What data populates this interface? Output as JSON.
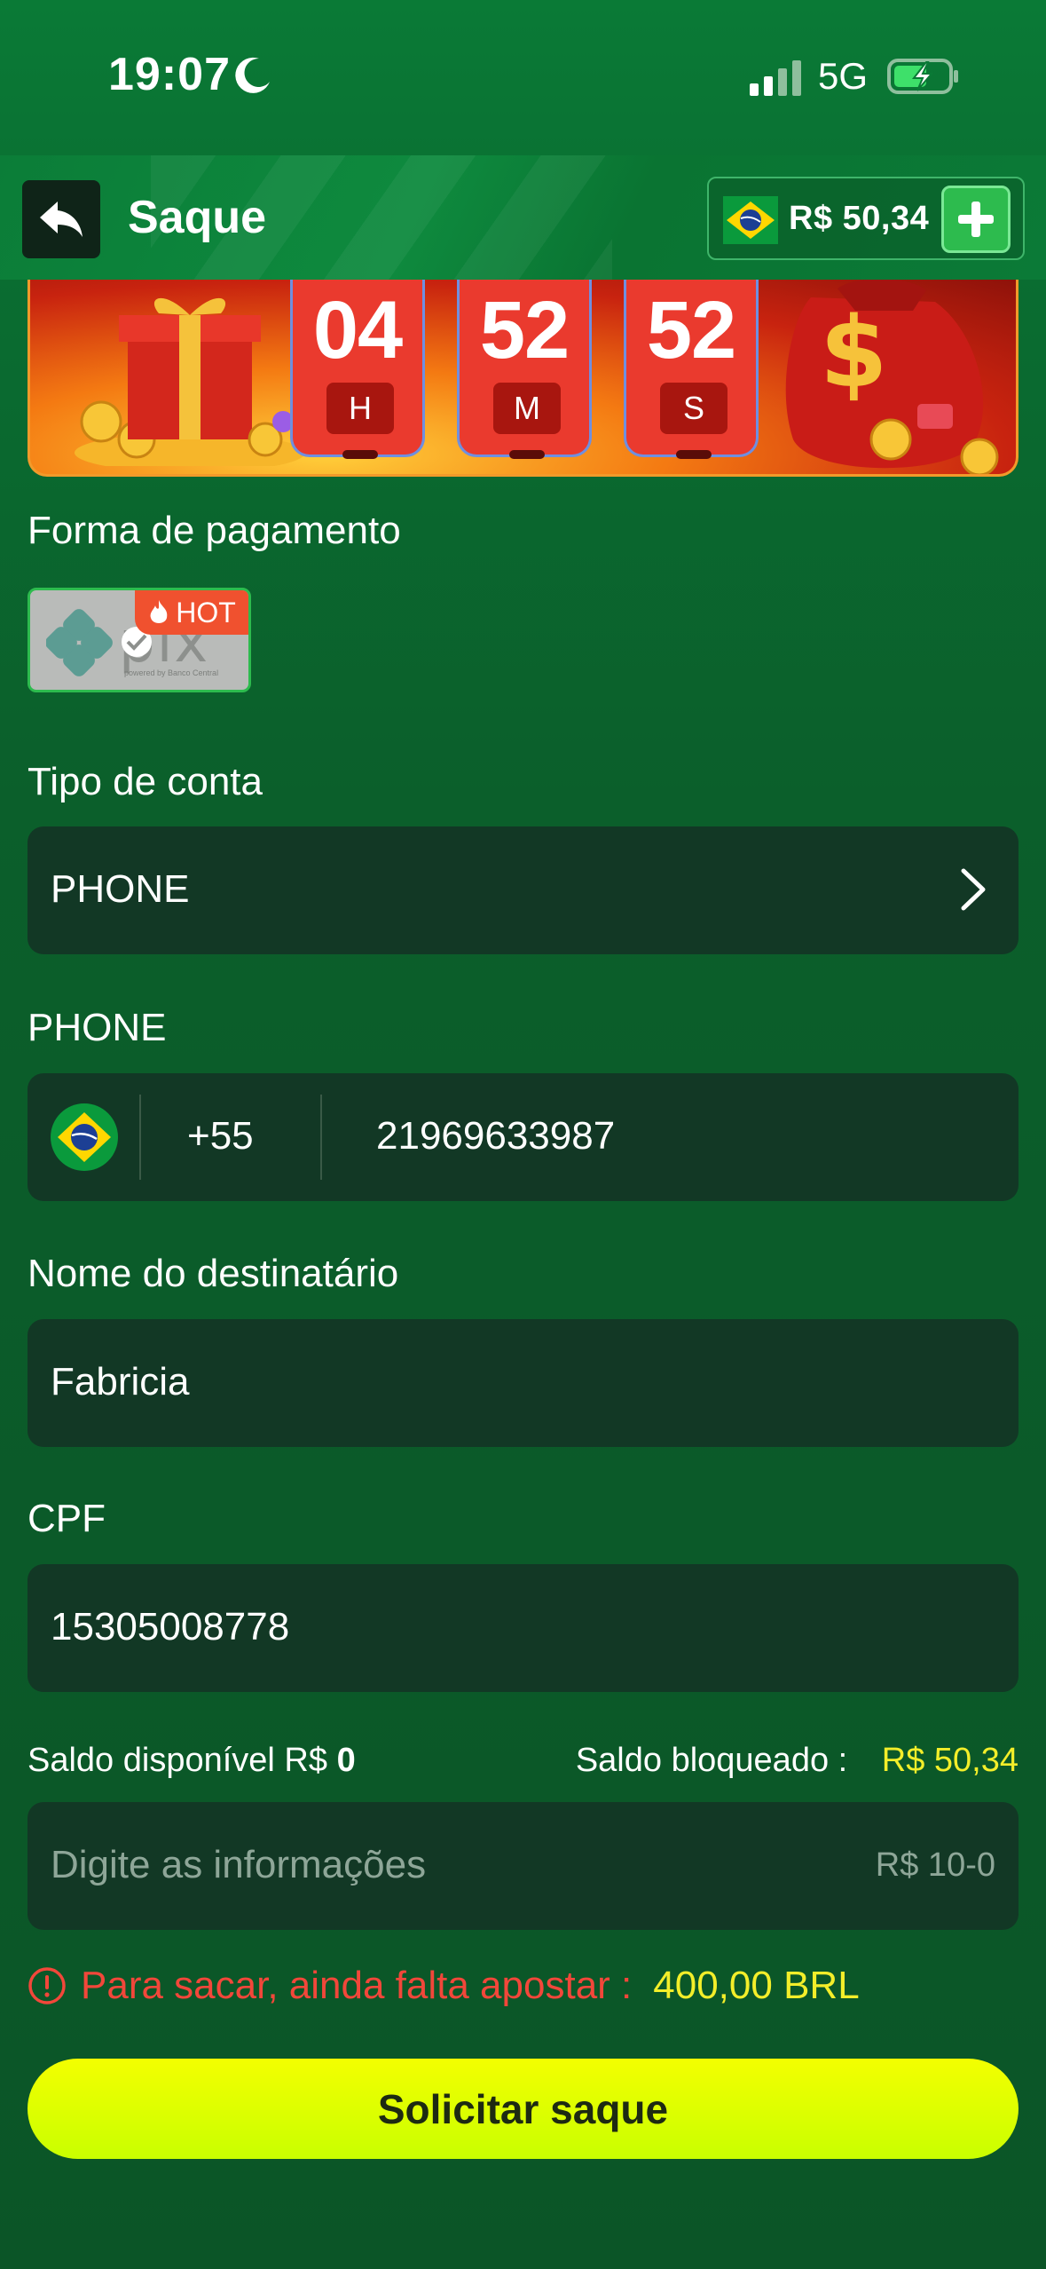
{
  "status_bar": {
    "time": "19:07",
    "network": "5G"
  },
  "header": {
    "title": "Saque",
    "balance": "R$ 50,34"
  },
  "banner": {
    "timer": [
      {
        "value": "04",
        "unit": "H"
      },
      {
        "value": "52",
        "unit": "M"
      },
      {
        "value": "52",
        "unit": "S"
      }
    ]
  },
  "payment": {
    "label": "Forma de pagamento",
    "method": "pix",
    "method_sub": "powered by Banco Central",
    "badge": "HOT"
  },
  "account_type": {
    "label": "Tipo de conta",
    "value": "PHONE"
  },
  "phone": {
    "label": "PHONE",
    "country_code": "+55",
    "number": "21969633987"
  },
  "recipient": {
    "label": "Nome do destinatário",
    "value": "Fabricia"
  },
  "cpf": {
    "label": "CPF",
    "value": "15305008778"
  },
  "saldo": {
    "available_label": "Saldo disponível R$",
    "available_value": "0",
    "blocked_label": "Saldo bloqueado :",
    "blocked_value": "R$ 50,34"
  },
  "amount": {
    "placeholder": "Digite as informações",
    "range": "R$ 10-0"
  },
  "warning": {
    "text": "Para sacar, ainda falta apostar :",
    "amount": "400,00 BRL"
  },
  "submit": {
    "label": "Solicitar saque"
  },
  "colors": {
    "accent_green": "#2dbb4e",
    "highlight_yellow": "#f3ee2a",
    "warning_red": "#f2473a",
    "field_bg": "#123825"
  }
}
